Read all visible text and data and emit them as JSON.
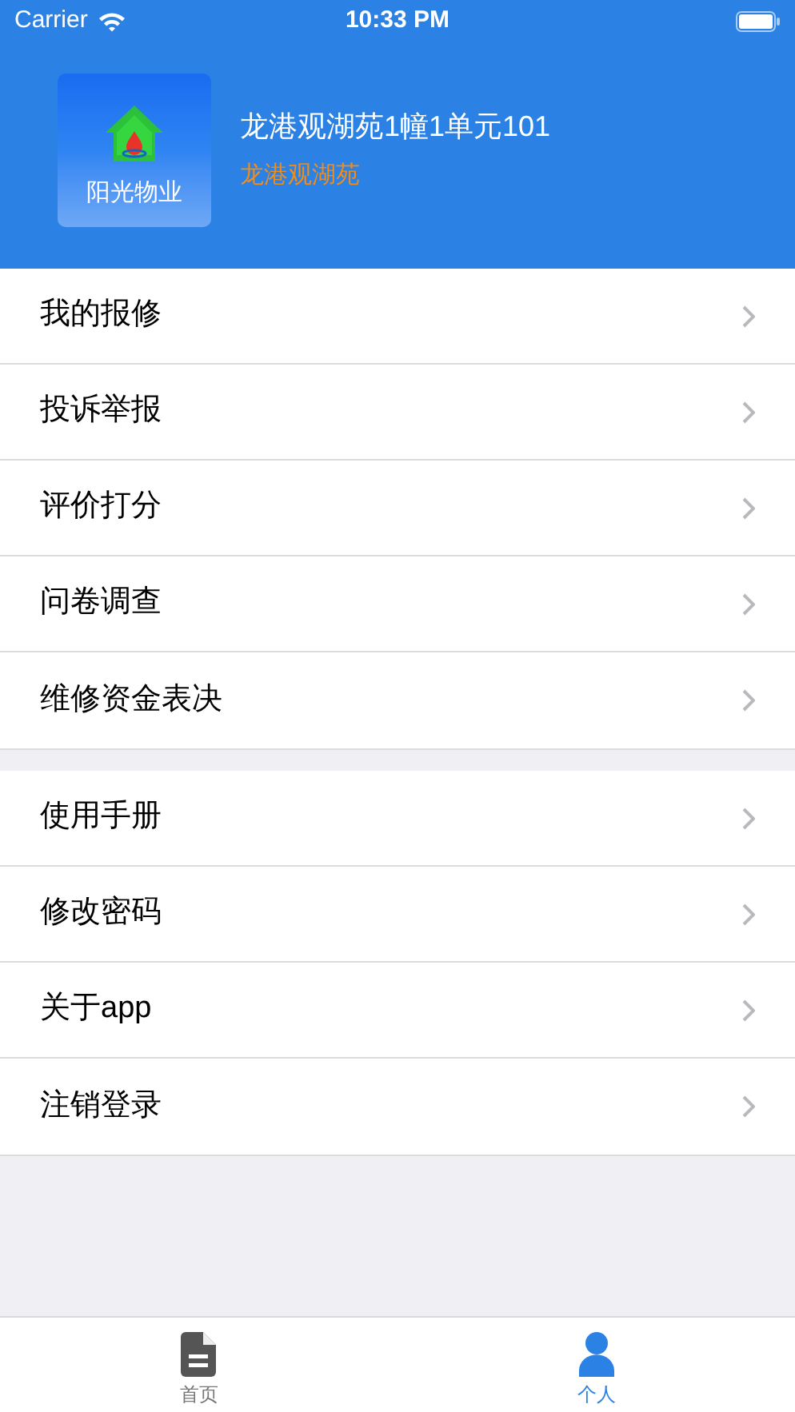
{
  "status_bar": {
    "carrier": "Carrier",
    "time": "10:33 PM"
  },
  "profile": {
    "logo_text": "阳光物业",
    "address": "龙港观湖苑1幢1单元101",
    "community": "龙港观湖苑"
  },
  "menu_groups": [
    {
      "items": [
        {
          "label": "我的报修"
        },
        {
          "label": "投诉举报"
        },
        {
          "label": "评价打分"
        },
        {
          "label": "问卷调查"
        },
        {
          "label": "维修资金表决"
        }
      ]
    },
    {
      "items": [
        {
          "label": "使用手册"
        },
        {
          "label": "修改密码"
        },
        {
          "label": "关于app"
        },
        {
          "label": "注销登录"
        }
      ]
    }
  ],
  "tab_bar": [
    {
      "kind": "document",
      "label": "首页",
      "selected": false
    },
    {
      "kind": "person",
      "label": "个人",
      "selected": true
    }
  ]
}
